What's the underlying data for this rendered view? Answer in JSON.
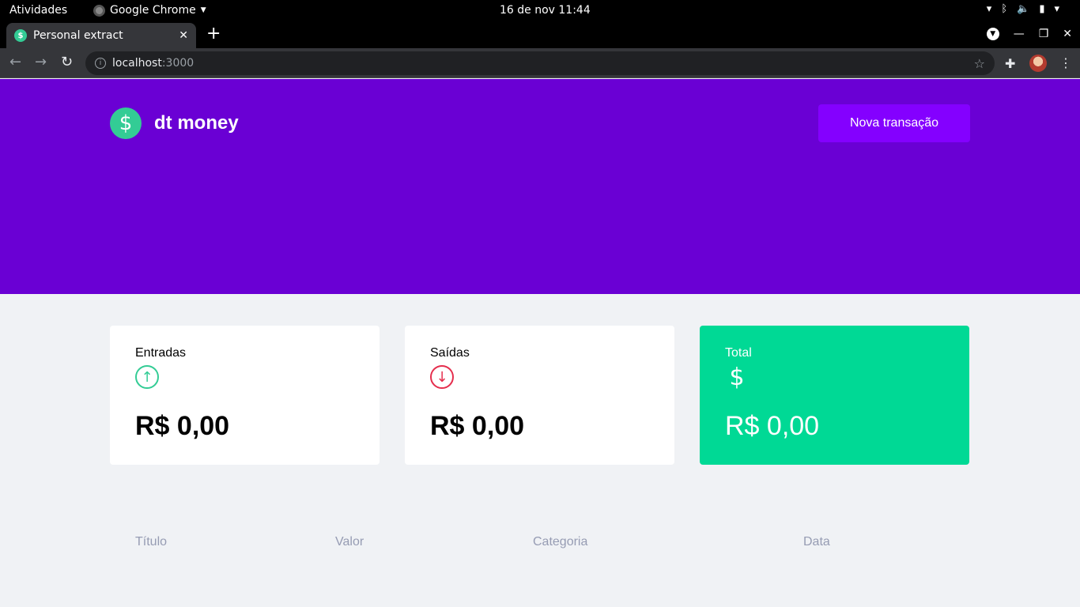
{
  "os": {
    "activities": "Atividades",
    "app_name": "Google Chrome",
    "clock": "16 de nov  11:44"
  },
  "browser": {
    "tab_title": "Personal extract",
    "url_host": "localhost",
    "url_port": ":3000"
  },
  "app": {
    "logo_text": "dt money",
    "new_transaction_label": "Nova transação",
    "cards": [
      {
        "label": "Entradas",
        "value": "R$ 0,00",
        "icon": "arrow-up-circle-icon"
      },
      {
        "label": "Saídas",
        "value": "R$ 0,00",
        "icon": "arrow-down-circle-icon"
      },
      {
        "label": "Total",
        "value": "R$ 0,00",
        "icon": "dollar-icon"
      }
    ],
    "table_headers": [
      "Título",
      "Valor",
      "Categoria",
      "Data"
    ]
  },
  "colors": {
    "header_bg": "#6a00d4",
    "button_bg": "#8400ff",
    "green": "#00d995",
    "income": "#33cc95",
    "outcome": "#e52e4d"
  }
}
